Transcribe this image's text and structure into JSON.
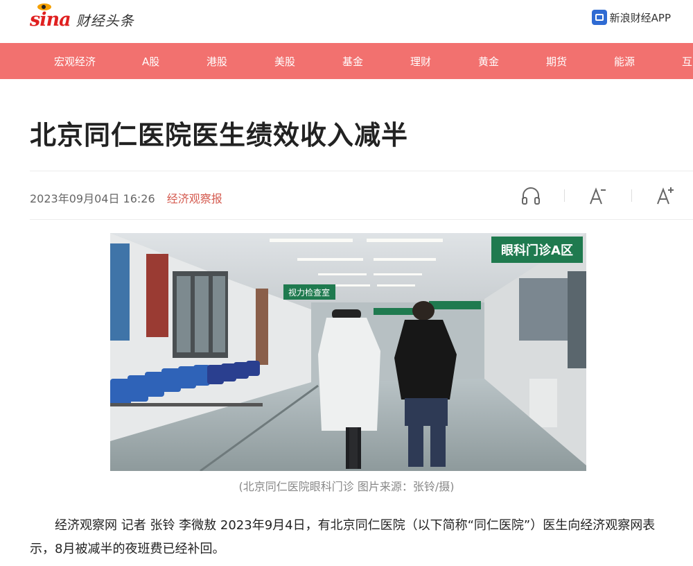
{
  "header": {
    "logo_text": "sina",
    "brand": "财经头条",
    "app_label": "新浪财经APP"
  },
  "nav": {
    "items": [
      "宏观经济",
      "A股",
      "港股",
      "美股",
      "基金",
      "理财",
      "黄金",
      "期货",
      "能源",
      "互"
    ]
  },
  "article": {
    "title": "北京同仁医院医生绩效收入减半",
    "date": "2023年09月04日 16:26",
    "source": "经济观察报",
    "photo_sign_1": "眼科门诊A区",
    "photo_sign_2": "视力检查室",
    "caption": "(北京同仁医院眼科门诊 图片来源：张铃/摄)",
    "paragraph": "经济观察网 记者 张铃 李微敖 2023年9月4日，有北京同仁医院（以下简称“同仁医院”）医生向经济观察网表示，8月被减半的夜班费已经补回。"
  },
  "tools": [
    "headphones-icon",
    "font-decrease-icon",
    "font-increase-icon"
  ],
  "colors": {
    "nav_bg": "#f2716f",
    "source": "#d45a4f",
    "logo": "#e02020"
  }
}
